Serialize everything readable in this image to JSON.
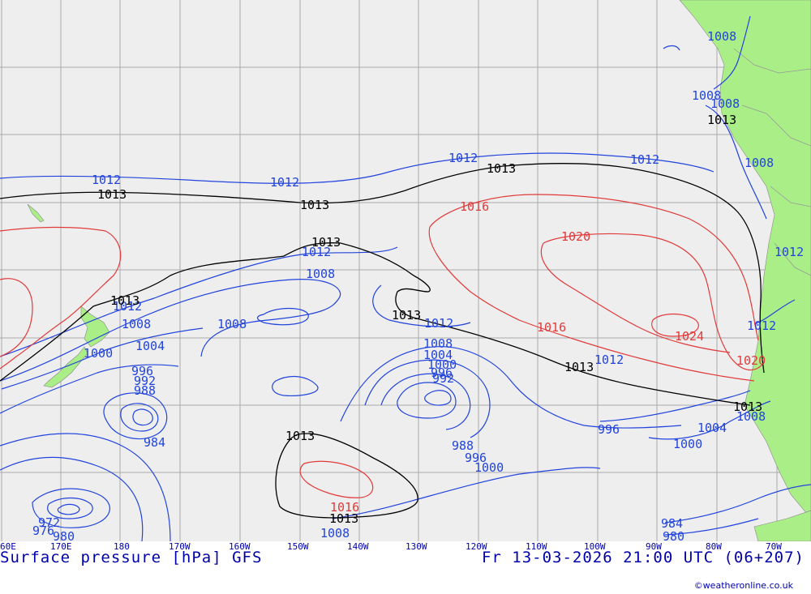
{
  "title": "Surface pressure [hPa] GFS",
  "valid_time": "Fr 13-03-2026 21:00 UTC (06+207)",
  "credit": "©weatheronline.co.uk",
  "longitude_labels": [
    "60E",
    "170E",
    "180",
    "170W",
    "160W",
    "150W",
    "140W",
    "130W",
    "120W",
    "110W",
    "100W",
    "90W",
    "80W",
    "70W"
  ],
  "isobar_labels": {
    "blue": [
      "1008",
      "1008",
      "1008",
      "1012",
      "1012",
      "1012",
      "1012",
      "1012",
      "1012",
      "1008",
      "1012",
      "1008",
      "1008",
      "1004",
      "1000",
      "996",
      "992",
      "988",
      "984",
      "980",
      "976",
      "972",
      "1012",
      "1008",
      "1004",
      "1000",
      "996",
      "992",
      "988",
      "996",
      "1000",
      "1012",
      "1012",
      "1008",
      "996",
      "1004",
      "1000",
      "984",
      "980",
      "1008",
      "1008"
    ],
    "black": [
      "1013",
      "1013",
      "1013",
      "1013",
      "1013",
      "1013",
      "1013",
      "1013",
      "1013",
      "1013",
      "1013"
    ],
    "red": [
      "1016",
      "1020",
      "1016",
      "1024",
      "1020",
      "1016"
    ]
  },
  "colors": {
    "sea": "#eeeeee",
    "land": "#aaee88",
    "grid": "#aaaaaa",
    "isobar_low": "#2244dd",
    "isobar_std": "#000000",
    "isobar_high": "#e23a3a",
    "text": "#0000aa"
  }
}
